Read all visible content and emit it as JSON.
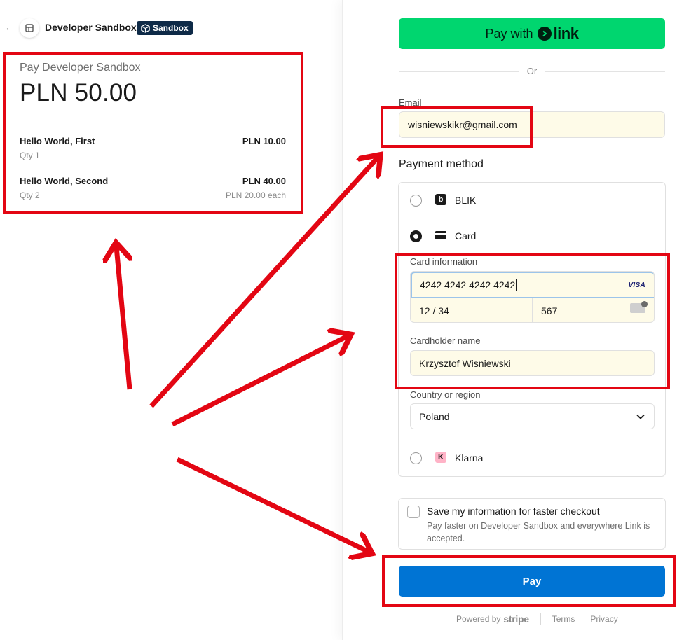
{
  "merchant": {
    "name": "Developer Sandbox",
    "badge": "Sandbox"
  },
  "summary": {
    "pay_label": "Pay Developer Sandbox",
    "total": "PLN 50.00",
    "items": [
      {
        "name": "Hello World, First",
        "qty": "Qty 1",
        "price": "PLN 10.00",
        "each": ""
      },
      {
        "name": "Hello World, Second",
        "qty": "Qty 2",
        "price": "PLN 40.00",
        "each": "PLN 20.00 each"
      }
    ]
  },
  "checkout": {
    "link_button": {
      "prefix": "Pay with",
      "brand": "link"
    },
    "or_text": "Or",
    "email": {
      "label": "Email",
      "value": "wisniewskikr@gmail.com"
    },
    "payment_method_title": "Payment method",
    "methods": {
      "blik": {
        "label": "BLIK",
        "icon": "blik-icon",
        "selected": false
      },
      "card": {
        "label": "Card",
        "icon": "card-icon",
        "selected": true
      },
      "klarna": {
        "label": "Klarna",
        "icon": "klarna-icon",
        "selected": false
      }
    },
    "card_info": {
      "label": "Card information",
      "number": "4242 4242 4242 4242",
      "brand": "VISA",
      "expiry": "12 / 34",
      "cvc": "567"
    },
    "cardholder": {
      "label": "Cardholder name",
      "value": "Krzysztof Wisniewski"
    },
    "country": {
      "label": "Country or region",
      "value": "Poland"
    },
    "save_info": {
      "title": "Save my information for faster checkout",
      "description": "Pay faster on Developer Sandbox and everywhere Link is accepted.",
      "checked": false
    },
    "pay_button": "Pay",
    "footer": {
      "powered_by": "Powered by",
      "brand": "stripe",
      "terms": "Terms",
      "privacy": "Privacy"
    }
  },
  "colors": {
    "link_green": "#00d66f",
    "pay_blue": "#0074d4",
    "annotation_red": "#e30613",
    "autofill_yellow": "#fefbe8",
    "sandbox_badge": "#0e2a47"
  }
}
